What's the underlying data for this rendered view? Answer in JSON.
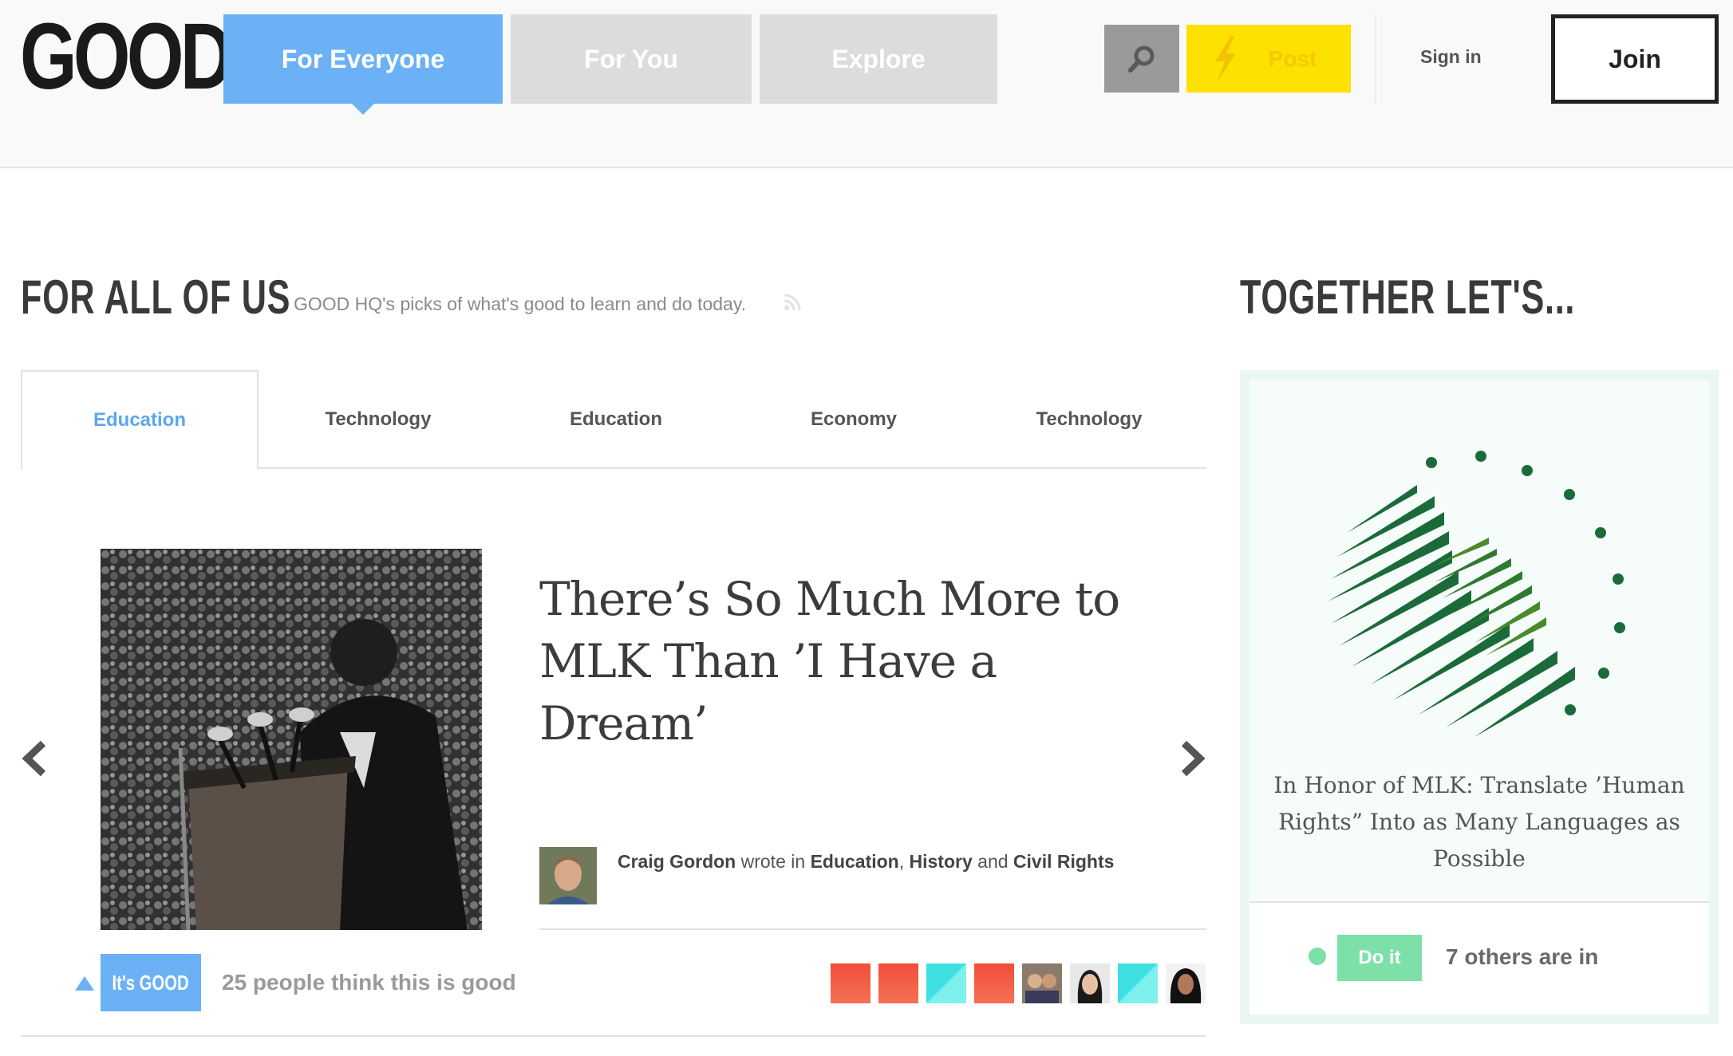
{
  "header": {
    "logo": "GOOD",
    "tabs": [
      {
        "label": "For Everyone",
        "active": true
      },
      {
        "label": "For You",
        "active": false
      },
      {
        "label": "Explore",
        "active": false
      }
    ],
    "search_icon": "search-icon",
    "post_label": "Post",
    "signin_label": "Sign in",
    "join_label": "Join",
    "colors": {
      "active_tab": "#6cb1f6",
      "post": "#fde100"
    }
  },
  "main": {
    "section_title": "FOR ALL OF US",
    "section_subtitle": "GOOD HQ's picks of what's good to learn and do today.",
    "categories": [
      {
        "label": "Education",
        "active": true
      },
      {
        "label": "Technology",
        "active": false
      },
      {
        "label": "Education",
        "active": false
      },
      {
        "label": "Economy",
        "active": false
      },
      {
        "label": "Technology",
        "active": false
      }
    ],
    "feature": {
      "headline": "There’s So Much More to MLK Than ’I Have a Dream’",
      "author": "Craig Gordon",
      "wrote_in": "wrote in",
      "topics": [
        "Education",
        "History",
        "Civil Rights"
      ],
      "topic_sep": ",",
      "topic_and": "and",
      "its_good_label": "It's GOOD",
      "good_count_text": "25 people think this is good"
    }
  },
  "sidebar": {
    "title": "TOGETHER LET'S...",
    "card_text": "In Honor of MLK: Translate ’Human Rights” Into as Many Languages as Possible",
    "doit_label": "Do it",
    "others_text": "7 others are in",
    "colors": {
      "accent": "#7de0a8",
      "logo_green": "#1b6b3a"
    }
  }
}
